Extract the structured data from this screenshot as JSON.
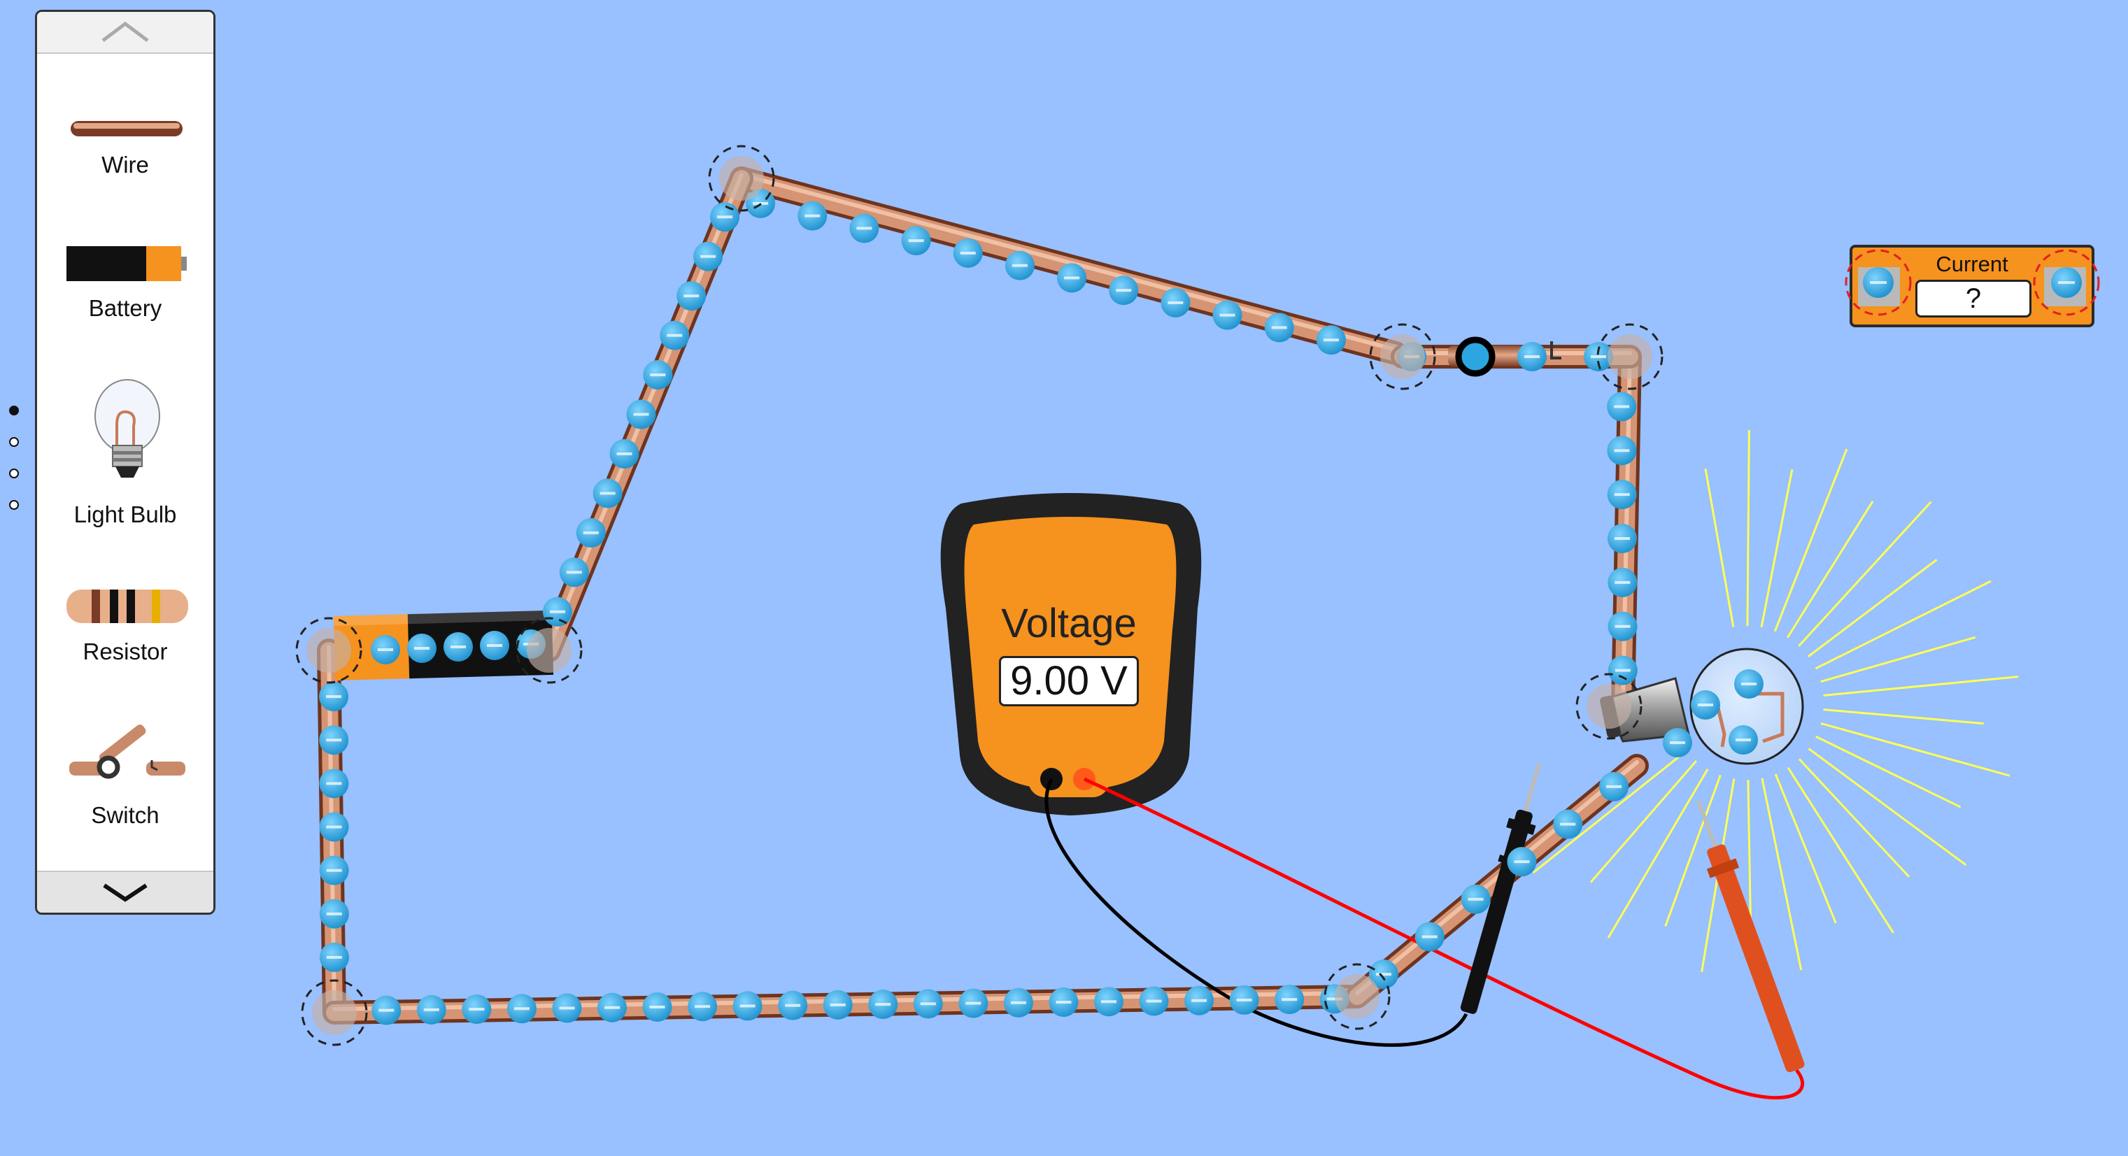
{
  "toolbox": {
    "items": [
      {
        "label": "Wire",
        "icon": "wire-icon"
      },
      {
        "label": "Battery",
        "icon": "battery-icon"
      },
      {
        "label": "Light Bulb",
        "icon": "light-bulb-icon"
      },
      {
        "label": "Resistor",
        "icon": "resistor-icon"
      },
      {
        "label": "Switch",
        "icon": "switch-icon"
      }
    ],
    "scroll_up_icon": "chevron-up-icon",
    "scroll_down_icon": "chevron-down-icon"
  },
  "page_indicator": {
    "count": 4,
    "active": 0
  },
  "voltmeter": {
    "label": "Voltage",
    "value": "9.00 V"
  },
  "ammeter": {
    "label": "Current",
    "value": "?"
  },
  "colors": {
    "background": "#99c0ff",
    "wire": "#c98a6a",
    "electron": "#2ba6e0",
    "meter_orange": "#f6921e",
    "probe_red": "#ff0000",
    "probe_black": "#000000",
    "light_rays": "#ffff33"
  }
}
